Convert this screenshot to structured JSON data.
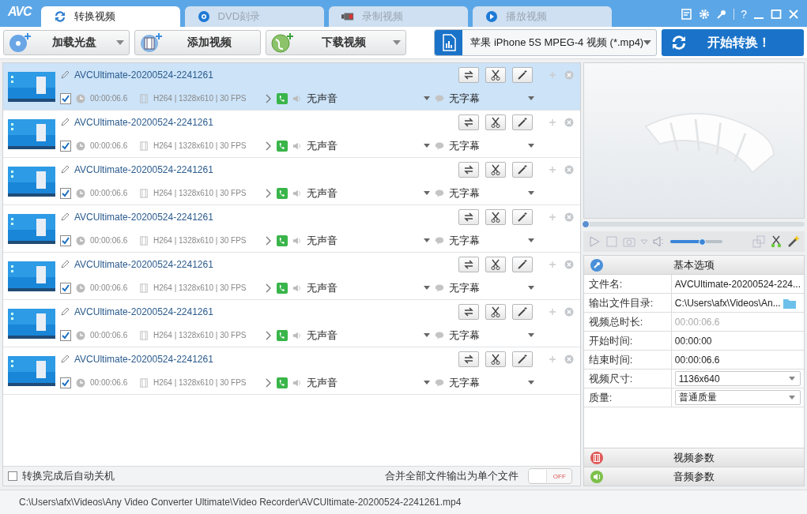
{
  "app_logo": "AVC",
  "tabs": [
    {
      "label": "转换视频",
      "selected": true,
      "kind": "convert"
    },
    {
      "label": "DVD刻录",
      "selected": false,
      "kind": "dvd"
    },
    {
      "label": "录制视频",
      "selected": false,
      "kind": "record"
    },
    {
      "label": "播放视频",
      "selected": false,
      "kind": "play"
    }
  ],
  "help": "?",
  "toolbar": [
    {
      "label": "加载光盘",
      "kind": "disc",
      "has_menu": true
    },
    {
      "label": "添加视频",
      "kind": "film",
      "has_menu": false
    },
    {
      "label": "下载视频",
      "kind": "globe",
      "has_menu": true
    }
  ],
  "profile": {
    "value": "苹果 iPhone 5S MPEG-4 视频 (*.mp4)"
  },
  "convert_button": "开始转换！",
  "files": [
    {
      "name": "AVCUltimate-20200524-2241261",
      "selected": true,
      "checked": true,
      "duration": "00:00:06.6",
      "video_info": "H264 | 1328x610 | 30 FPS",
      "audio": "无声音",
      "subtitle": "无字幕"
    },
    {
      "name": "AVCUltimate-20200524-2241261",
      "selected": false,
      "checked": true,
      "duration": "00:00:06.6",
      "video_info": "H264 | 1328x610 | 30 FPS",
      "audio": "无声音",
      "subtitle": "无字幕"
    },
    {
      "name": "AVCUltimate-20200524-2241261",
      "selected": false,
      "checked": true,
      "duration": "00:00:06.6",
      "video_info": "H264 | 1328x610 | 30 FPS",
      "audio": "无声音",
      "subtitle": "无字幕"
    },
    {
      "name": "AVCUltimate-20200524-2241261",
      "selected": false,
      "checked": true,
      "duration": "00:00:06.6",
      "video_info": "H264 | 1328x610 | 30 FPS",
      "audio": "无声音",
      "subtitle": "无字幕"
    },
    {
      "name": "AVCUltimate-20200524-2241261",
      "selected": false,
      "checked": true,
      "duration": "00:00:06.6",
      "video_info": "H264 | 1328x610 | 30 FPS",
      "audio": "无声音",
      "subtitle": "无字幕"
    },
    {
      "name": "AVCUltimate-20200524-2241261",
      "selected": false,
      "checked": true,
      "duration": "00:00:06.6",
      "video_info": "H264 | 1328x610 | 30 FPS",
      "audio": "无声音",
      "subtitle": "无字幕"
    },
    {
      "name": "AVCUltimate-20200524-2241261",
      "selected": false,
      "checked": true,
      "duration": "00:00:06.6",
      "video_info": "H264 | 1328x610 | 30 FPS",
      "audio": "无声音",
      "subtitle": "无字幕"
    }
  ],
  "shutdown": {
    "label": "转换完成后自动关机",
    "checked": false
  },
  "merge": {
    "label": "合并全部文件输出为单个文件",
    "on": false,
    "state_text": "OFF"
  },
  "player": {
    "seek": {
      "level": 0
    },
    "volume": {
      "level": 0.6
    }
  },
  "basic_options": {
    "title": "基本选项",
    "rows": [
      {
        "label": "文件名:",
        "value": "AVCUltimate-20200524-224...",
        "kind": "text"
      },
      {
        "label": "输出文件目录:",
        "value": "C:\\Users\\afx\\Videos\\An...",
        "kind": "folder"
      },
      {
        "label": "视频总时长:",
        "value": "00:00:06.6",
        "kind": "muted"
      },
      {
        "label": "开始时间:",
        "value": "00:00:00",
        "kind": "text"
      },
      {
        "label": "结束时间:",
        "value": "00:00:06.6",
        "kind": "text"
      },
      {
        "label": "视频尺寸:",
        "value": "1136x640",
        "kind": "select"
      },
      {
        "label": "质量:",
        "value": "普通质量",
        "kind": "select"
      }
    ]
  },
  "sections": [
    {
      "label": "视频参数",
      "kind": "video"
    },
    {
      "label": "音频参数",
      "kind": "audio"
    }
  ],
  "status_path": "C:\\Users\\afx\\Videos\\Any Video Converter Ultimate\\Video Recorder\\AVCUltimate-20200524-2241261.mp4"
}
